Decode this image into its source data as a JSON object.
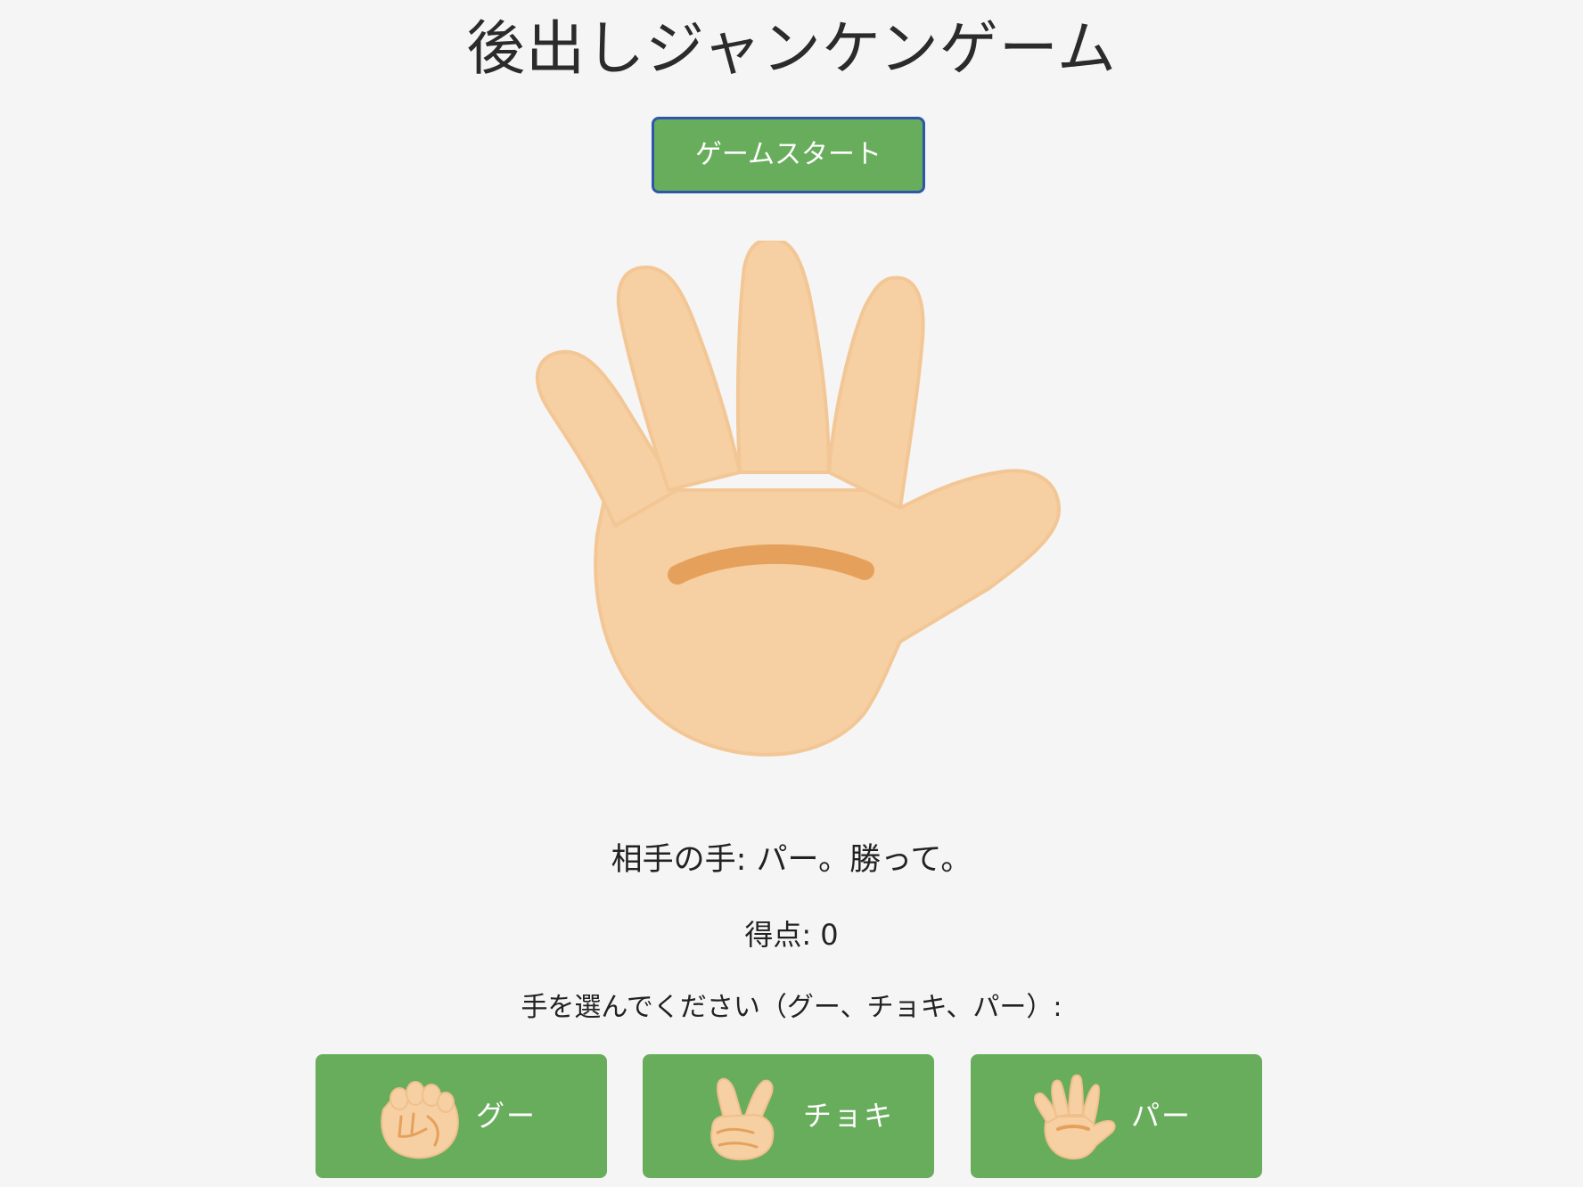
{
  "title": "後出しジャンケンゲーム",
  "start_button": {
    "label": "ゲームスタート"
  },
  "opponent": {
    "hand_icon": "paper-hand-icon",
    "message": "相手の手: パー。勝って。"
  },
  "score": {
    "text": "得点: 0"
  },
  "prompt": {
    "text": "手を選んでください（グー、チョキ、パー）:"
  },
  "choices": [
    {
      "label": "グー",
      "icon": "rock-fist-icon"
    },
    {
      "label": "チョキ",
      "icon": "scissors-hand-icon"
    },
    {
      "label": "パー",
      "icon": "paper-hand-icon"
    }
  ],
  "colors": {
    "background": "#f5f5f5",
    "button_green": "#68ad5c",
    "button_border": "#2f57a8",
    "skin": "#f6cfa2",
    "skin_line": "#e5a15c"
  }
}
